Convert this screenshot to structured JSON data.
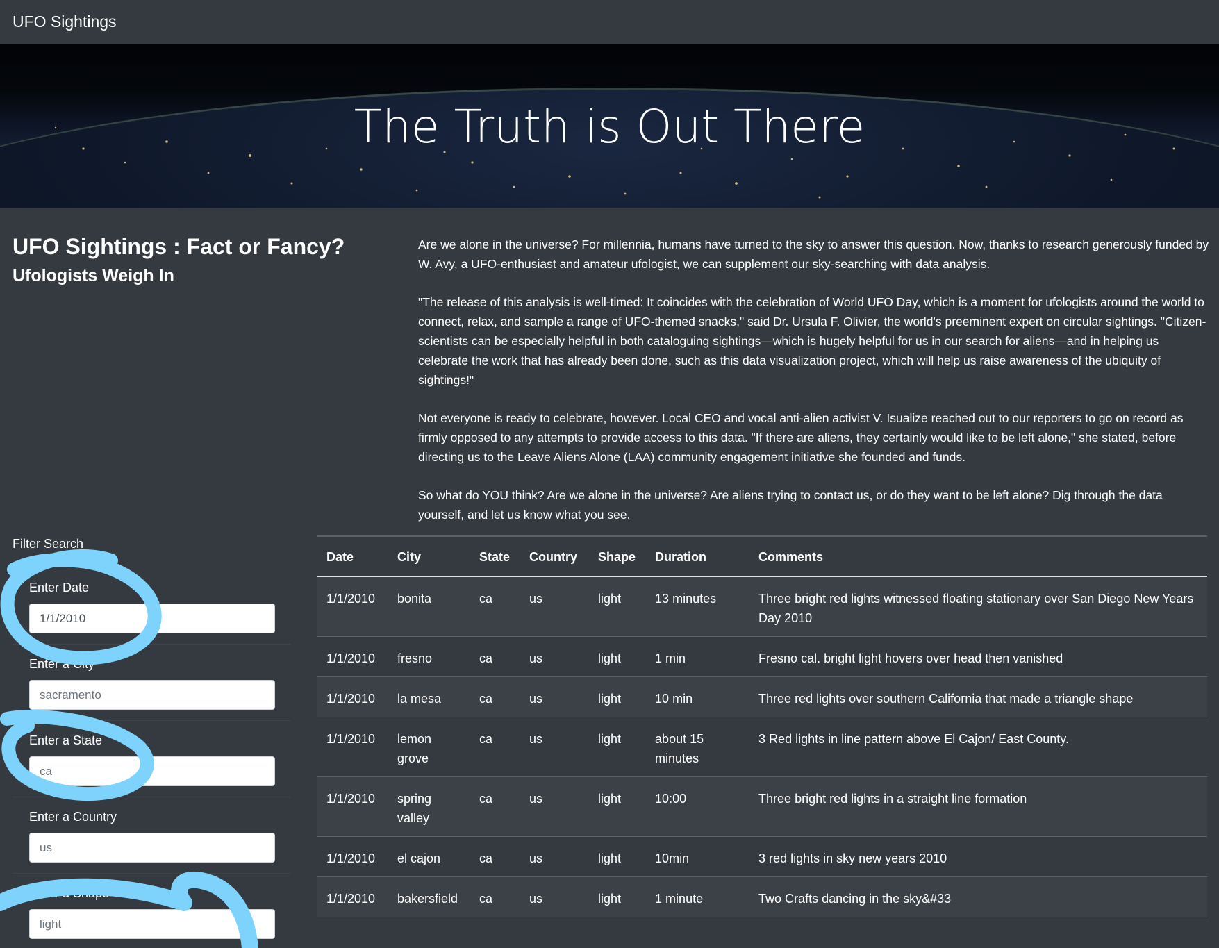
{
  "navbar": {
    "brand": "UFO Sightings"
  },
  "hero": {
    "title": "The Truth is Out There"
  },
  "intro": {
    "headline": "UFO Sightings : Fact or Fancy?",
    "subheadline": "Ufologists Weigh In"
  },
  "article": {
    "paragraphs": [
      "Are we alone in the universe? For millennia, humans have turned to the sky to answer this question. Now, thanks to research generously funded by W. Avy, a UFO-enthusiast and amateur ufologist, we can supplement our sky-searching with data analysis.",
      "\"The release of this analysis is well-timed: It coincides with the celebration of World UFO Day, which is a moment for ufologists around the world to connect, relax, and sample a range of UFO-themed snacks,\" said Dr. Ursula F. Olivier, the world's preeminent expert on circular sightings. \"Citizen-scientists can be especially helpful in both cataloguing sightings—which is hugely helpful for us in our search for aliens—and in helping us celebrate the work that has already been done, such as this data visualization project, which will help us raise awareness of the ubiquity of sightings!\"",
      "Not everyone is ready to celebrate, however. Local CEO and vocal anti-alien activist V. Isualize reached out to our reporters to go on record as firmly opposed to any attempts to provide access to this data. \"If there are aliens, they certainly would like to be left alone,\" she stated, before directing us to the Leave Aliens Alone (LAA) community engagement initiative she founded and funds.",
      "So what do YOU think? Are we alone in the universe? Are aliens trying to contact us, or do they want to be left alone? Dig through the data yourself, and let us know what you see."
    ]
  },
  "filters": {
    "title": "Filter Search",
    "items": [
      {
        "label": "Enter Date",
        "value": "1/1/2010"
      },
      {
        "label": "Enter a City",
        "value": "sacramento"
      },
      {
        "label": "Enter a State",
        "value": "ca"
      },
      {
        "label": "Enter a Country",
        "value": "us"
      },
      {
        "label": "Enter a Shape",
        "value": "light"
      }
    ]
  },
  "table": {
    "headers": [
      "Date",
      "City",
      "State",
      "Country",
      "Shape",
      "Duration",
      "Comments"
    ],
    "rows": [
      [
        "1/1/2010",
        "bonita",
        "ca",
        "us",
        "light",
        "13 minutes",
        "Three bright red lights witnessed floating stationary over San Diego New Years Day 2010"
      ],
      [
        "1/1/2010",
        "fresno",
        "ca",
        "us",
        "light",
        "1 min",
        "Fresno cal. bright light hovers over head then vanished"
      ],
      [
        "1/1/2010",
        "la mesa",
        "ca",
        "us",
        "light",
        "10 min",
        "Three red lights over southern California that made a triangle shape"
      ],
      [
        "1/1/2010",
        "lemon grove",
        "ca",
        "us",
        "light",
        "about 15 minutes",
        "3 Red lights in line pattern above El Cajon/ East County."
      ],
      [
        "1/1/2010",
        "spring valley",
        "ca",
        "us",
        "light",
        "10:00",
        "Three bright red lights in a straight line formation"
      ],
      [
        "1/1/2010",
        "el cajon",
        "ca",
        "us",
        "light",
        "10min",
        "3 red lights in sky new years 2010"
      ],
      [
        "1/1/2010",
        "bakersfield",
        "ca",
        "us",
        "light",
        "1 minute",
        "Two Crafts dancing in the sky&#33"
      ]
    ]
  },
  "colors": {
    "background": "#343a40",
    "annotation": "#7dd3fc"
  }
}
